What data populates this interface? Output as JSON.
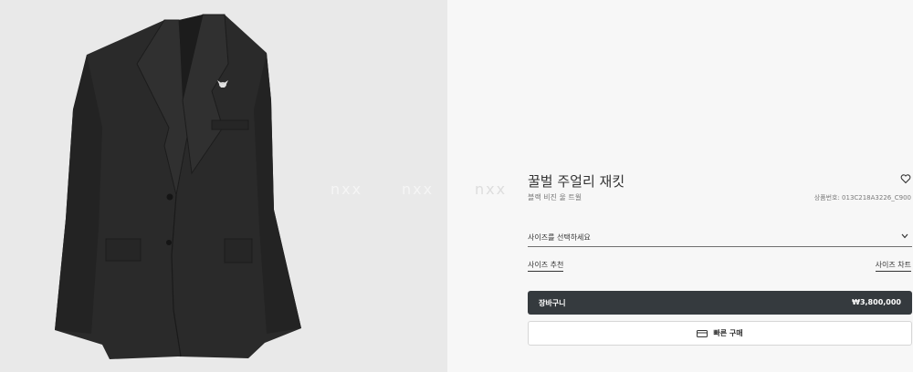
{
  "watermarks": [
    "nxx",
    "nxx",
    "nxx"
  ],
  "product": {
    "title": "꿀벌 주얼리 재킷",
    "subtitle": "블랙 비진 울 트윌",
    "code": "상품번호: 013C218A3226_C900"
  },
  "size": {
    "placeholder": "사이즈를 선택하세요",
    "recommendation_link": "사이즈 추천",
    "chart_link": "사이즈 차트"
  },
  "cart": {
    "label": "장바구니",
    "price": "₩3,800,000"
  },
  "quick_buy": {
    "label": "빠른 구매",
    "icon": "credit-card-icon"
  },
  "icons": {
    "wishlist": "heart-icon",
    "select": "chevron-down-icon"
  },
  "colors": {
    "image_bg": "#e9e9e9",
    "page_bg": "#f7f7f7",
    "cart_button_bg": "#353a3e",
    "jacket": "#2a2a2a"
  }
}
